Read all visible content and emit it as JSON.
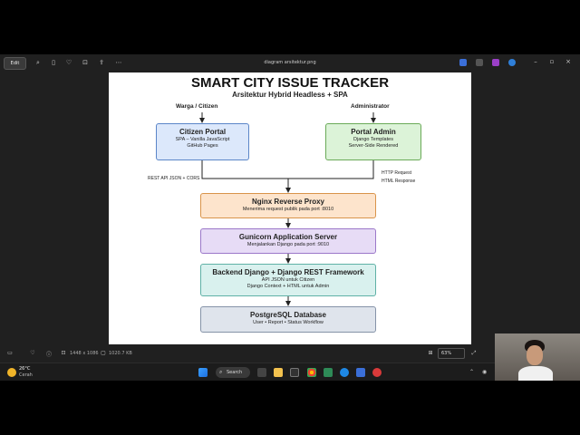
{
  "toolbar": {
    "edit_label": "Edit",
    "file_title": "diagram arsitektur.png"
  },
  "diagram": {
    "title": "SMART CITY ISSUE TRACKER",
    "subtitle": "Arsitektur Hybrid Headless + SPA",
    "actor_citizen": "Warga / Citizen",
    "actor_admin": "Administrator",
    "citizen_portal": {
      "title": "Citizen Portal",
      "line1": "SPA – Vanilla JavaScript",
      "line2": "GitHub Pages"
    },
    "portal_admin": {
      "title": "Portal Admin",
      "line1": "Django Templates",
      "line2": "Server-Side Rendered"
    },
    "edge_left": "REST API JSON + CORS",
    "edge_right_1": "HTTP Request",
    "edge_right_2": "HTML Response",
    "nginx": {
      "title": "Nginx Reverse Proxy",
      "line1": "Menerima request publik pada port :8010"
    },
    "gunicorn": {
      "title": "Gunicorn Application Server",
      "line1": "Menjalankan Django pada port :9010"
    },
    "backend": {
      "title": "Backend Django + Django REST Framework",
      "line1": "API JSON untuk Citizen",
      "line2": "Django Context + HTML untuk Admin"
    },
    "postgres": {
      "title": "PostgreSQL Database",
      "line1": "User • Report • Status Workflow"
    }
  },
  "statusbar": {
    "dimensions": "1448 x 1086",
    "filesize": "1020.7 KB",
    "zoom": "63%"
  },
  "taskbar": {
    "temperature": "26°C",
    "condition": "Cerah",
    "search_label": "Search"
  },
  "colors": {
    "citizen_fill": "#dce8fb",
    "admin_fill": "#dcf3d8",
    "nginx_fill": "#fde4cc",
    "gunicorn_fill": "#e7dcf6",
    "backend_fill": "#d9f1ee",
    "postgres_fill": "#dfe4ec"
  }
}
